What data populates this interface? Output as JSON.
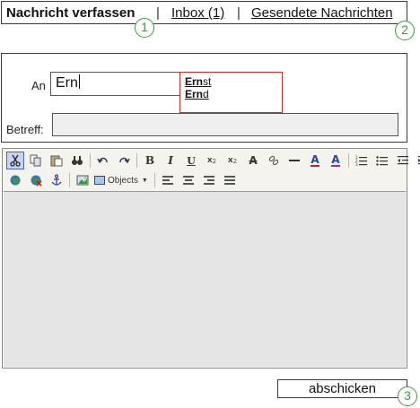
{
  "nav": {
    "current": "Nachricht verfassen",
    "separator": "|",
    "inbox": "Inbox (1)",
    "sent": "Gesendete Nachrichten"
  },
  "markers": [
    "1",
    "2",
    "3"
  ],
  "form": {
    "to_label": "An",
    "to_value": "Ern",
    "suggestions": [
      {
        "match": "Ern",
        "rest": "st"
      },
      {
        "match": "Ern",
        "rest": "d"
      }
    ],
    "subject_label": "Betreff:",
    "subject_value": ""
  },
  "toolbar": {
    "objects_label": "Objects",
    "bold": "B",
    "italic": "I",
    "underline": "U",
    "subscript_base": "x",
    "subscript_mark": "2",
    "superscript_base": "x",
    "superscript_mark": "2",
    "strike": "A",
    "font_color": "A",
    "highlight_color": "A",
    "icons_row1": [
      "cut-icon",
      "copy-icon",
      "paste-icon",
      "find-icon",
      "undo-icon",
      "redo-icon",
      "bold-icon",
      "italic-icon",
      "underline-icon",
      "subscript-icon",
      "superscript-icon",
      "strikethrough-icon",
      "unlink-icon",
      "horizontal-rule-icon",
      "font-color-icon",
      "highlight-color-icon",
      "ordered-list-icon",
      "unordered-list-icon",
      "outdent-icon",
      "indent-icon"
    ],
    "icons_row2": [
      "link-icon",
      "remove-link-icon",
      "anchor-icon",
      "image-icon",
      "objects-icon",
      "align-left-icon",
      "align-center-icon",
      "align-right-icon",
      "align-justify-icon"
    ]
  },
  "editor": {
    "content": ""
  },
  "actions": {
    "send": "abschicken"
  },
  "colors": {
    "marker_green": "#3a9a3a",
    "suggestion_border": "#c03030",
    "toolbar_bg": "#f4f3ee",
    "editor_bg": "#e5e5e5",
    "subject_bg": "#efefef"
  }
}
